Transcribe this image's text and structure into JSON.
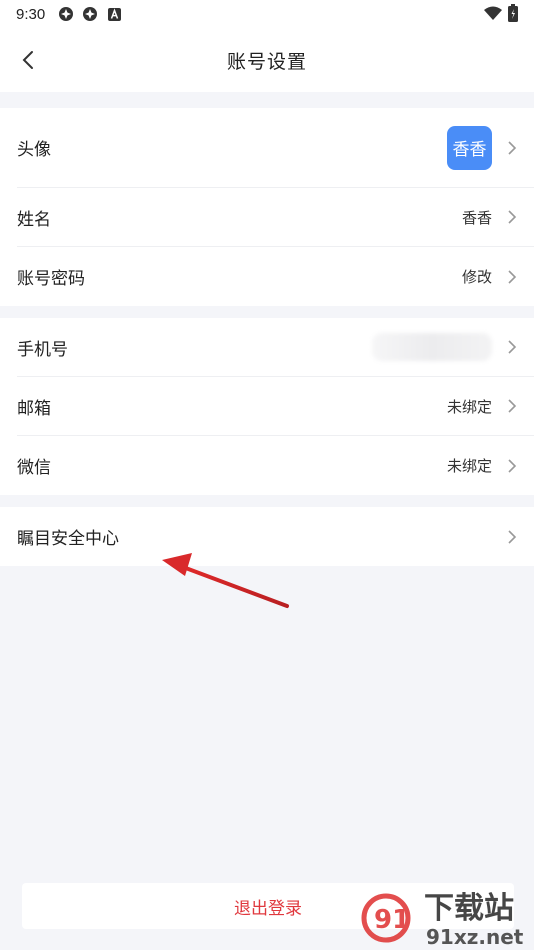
{
  "status": {
    "time": "9:30"
  },
  "header": {
    "title": "账号设置"
  },
  "groups": [
    [
      {
        "label": "头像",
        "avatar_text": "香香"
      },
      {
        "label": "姓名",
        "value": "香香"
      },
      {
        "label": "账号密码",
        "value": "修改"
      }
    ],
    [
      {
        "label": "手机号",
        "value": ""
      },
      {
        "label": "邮箱",
        "value": "未绑定"
      },
      {
        "label": "微信",
        "value": "未绑定"
      }
    ],
    [
      {
        "label": "瞩目安全中心"
      }
    ]
  ],
  "logout_label": "退出登录",
  "watermark": {
    "main": "下载站",
    "domain": "91xz.net",
    "logo": "91"
  },
  "colors": {
    "accent": "#4a8df7",
    "danger": "#e0383e",
    "annotation_arrow": "#d9292b"
  }
}
